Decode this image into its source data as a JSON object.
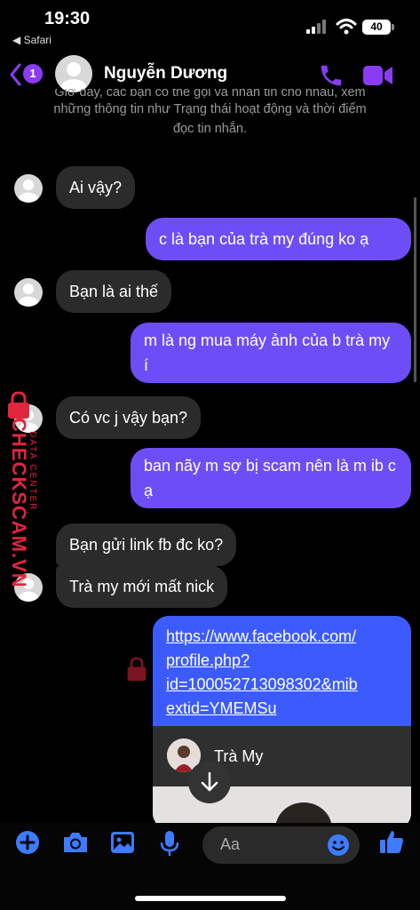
{
  "status_bar": {
    "time": "19:30",
    "back_app": "◀ Safari",
    "battery": "40"
  },
  "header": {
    "unread_count": "1",
    "contact_name": "Nguyễn Dương"
  },
  "notice": {
    "line1": "Giờ đây, các bạn có thể gọi và nhắn tin cho nhau, xem",
    "line2": "những thông tin như Trạng thái hoạt động và thời điểm",
    "line3": "đọc tin nhắn."
  },
  "messages": [
    {
      "dir": "in",
      "text": "Ai vậy?"
    },
    {
      "dir": "out",
      "text": "c là bạn của trà my đúng ko ạ"
    },
    {
      "dir": "in",
      "text": "Bạn là ai thế"
    },
    {
      "dir": "out",
      "text": "m là ng mua máy ảnh của b trà my í"
    },
    {
      "dir": "in",
      "text": "Có vc j vậy bạn?"
    },
    {
      "dir": "out",
      "text": "ban nãy m sợ bị scam nên là m ib c ạ"
    },
    {
      "dir": "in",
      "text": "Bạn gửi link fb đc ko?"
    },
    {
      "dir": "in",
      "text": "Trà my mới mất nick"
    }
  ],
  "link_message": {
    "url_lines": [
      "https://www.facebook.com/",
      "profile.php?",
      "id=100052713098302&mib",
      "extid=YMEMSu"
    ],
    "preview_name": "Trà My"
  },
  "watermark": {
    "brand": "CHECKSCAM.VN",
    "sub": "DATA CENTER"
  },
  "composer": {
    "placeholder": "Aa"
  },
  "colors": {
    "accent": "#8a3cf5",
    "outgoing": "#6d4ef6",
    "incoming": "#2b2b2b",
    "link_bubble": "#3c5bff",
    "toolbar_blue": "#3d7bff"
  }
}
